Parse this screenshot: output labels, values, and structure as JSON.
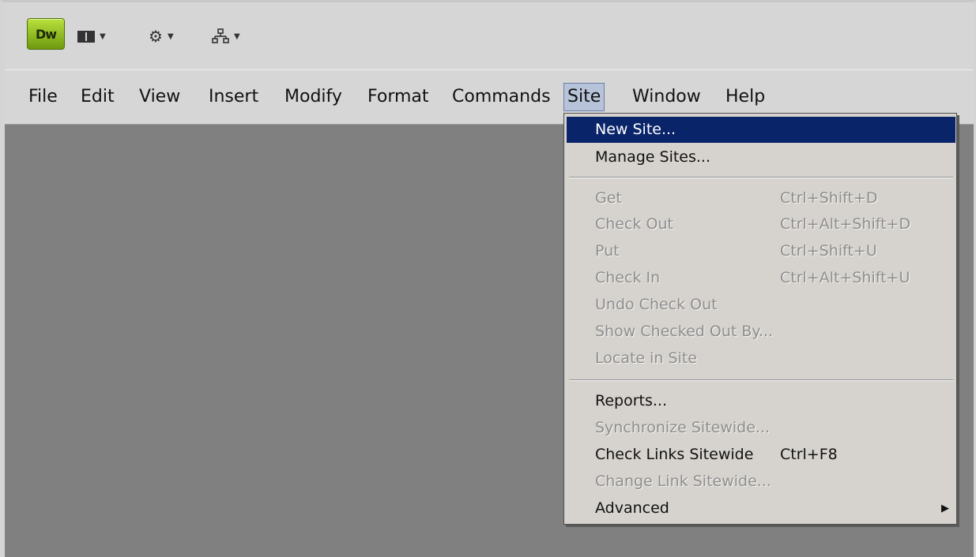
{
  "logo": {
    "text": "Dw"
  },
  "toolbar": {
    "icons": [
      {
        "name": "layout-icon"
      },
      {
        "name": "gear-icon"
      },
      {
        "name": "site-map-icon"
      }
    ]
  },
  "menubar": {
    "items": [
      "File",
      "Edit",
      "View",
      "Insert",
      "Modify",
      "Format",
      "Commands",
      "Site",
      "Window",
      "Help"
    ],
    "active": "Site"
  },
  "dropdown": {
    "items": [
      {
        "label": "New Site...",
        "shortcut": "",
        "enabled": true,
        "highlighted": true
      },
      {
        "label": "Manage Sites...",
        "shortcut": "",
        "enabled": true
      },
      {
        "label": "Get",
        "shortcut": "Ctrl+Shift+D",
        "enabled": false
      },
      {
        "label": "Check Out",
        "shortcut": "Ctrl+Alt+Shift+D",
        "enabled": false
      },
      {
        "label": "Put",
        "shortcut": "Ctrl+Shift+U",
        "enabled": false
      },
      {
        "label": "Check In",
        "shortcut": "Ctrl+Alt+Shift+U",
        "enabled": false
      },
      {
        "label": "Undo Check Out",
        "shortcut": "",
        "enabled": false
      },
      {
        "label": "Show Checked Out By...",
        "shortcut": "",
        "enabled": false
      },
      {
        "label": "Locate in Site",
        "shortcut": "",
        "enabled": false
      },
      {
        "label": "Reports...",
        "shortcut": "",
        "enabled": true
      },
      {
        "label": "Synchronize Sitewide...",
        "shortcut": "",
        "enabled": false
      },
      {
        "label": "Check Links Sitewide",
        "shortcut": "Ctrl+F8",
        "enabled": true
      },
      {
        "label": "Change Link Sitewide...",
        "shortcut": "",
        "enabled": false
      },
      {
        "label": "Advanced",
        "shortcut": "",
        "enabled": true,
        "submenu": true
      }
    ]
  },
  "colors": {
    "highlight": "#0a246a",
    "workspace": "#808080",
    "chrome": "#d6d6d6"
  }
}
